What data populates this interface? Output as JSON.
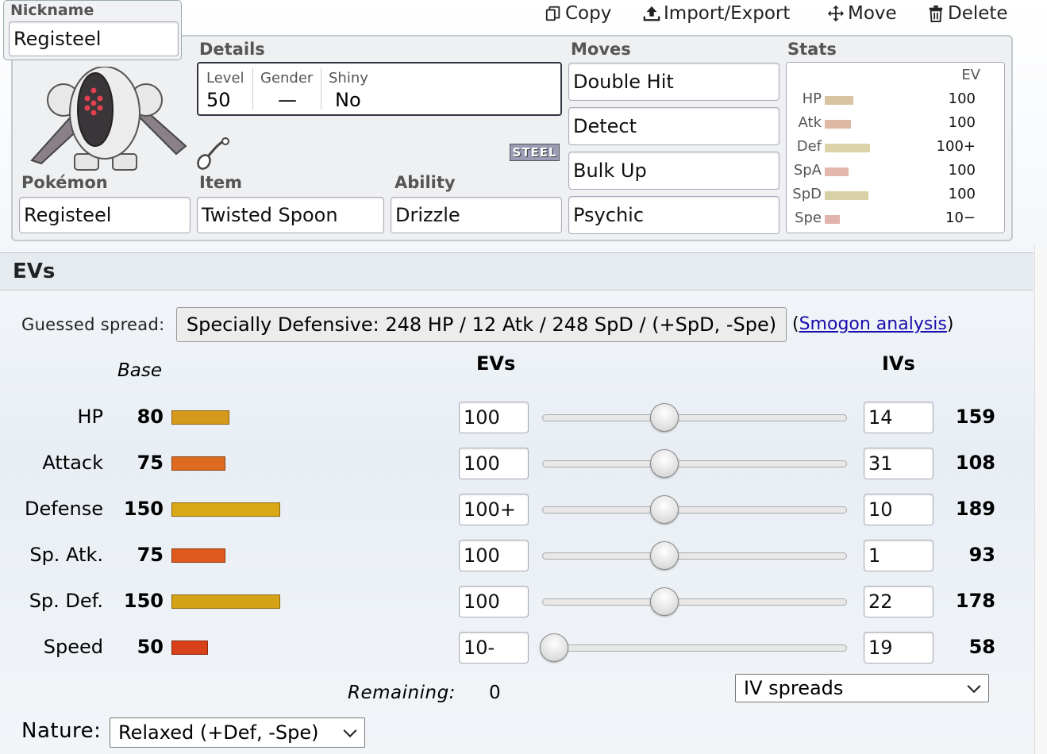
{
  "toolbar": {
    "copy": "Copy",
    "import_export": "Import/Export",
    "move": "Move",
    "delete": "Delete"
  },
  "nickname": {
    "label": "Nickname",
    "value": "Registeel"
  },
  "details": {
    "title": "Details",
    "level_label": "Level",
    "level": "50",
    "gender_label": "Gender",
    "gender": "—",
    "shiny_label": "Shiny",
    "shiny": "No",
    "type_badge": "STEEL"
  },
  "pokemon": {
    "label": "Pokémon",
    "value": "Registeel"
  },
  "item": {
    "label": "Item",
    "value": "Twisted Spoon",
    "icon": "spoon-icon"
  },
  "ability": {
    "label": "Ability",
    "value": "Drizzle"
  },
  "moves": {
    "title": "Moves",
    "list": [
      "Double Hit",
      "Detect",
      "Bulk Up",
      "Psychic"
    ]
  },
  "stats_summary": {
    "title": "Stats",
    "ev_header": "EV",
    "rows": [
      {
        "name": "HP",
        "ev": "100",
        "fill": 0.63
      },
      {
        "name": "Atk",
        "ev": "100",
        "fill": 0.58
      },
      {
        "name": "Def",
        "ev": "100+",
        "fill": 1.0
      },
      {
        "name": "SpA",
        "ev": "100",
        "fill": 0.52
      },
      {
        "name": "SpD",
        "ev": "100",
        "fill": 0.96
      },
      {
        "name": "Spe",
        "ev": "10−",
        "fill": 0.33
      }
    ]
  },
  "evs": {
    "section_title": "EVs",
    "guessed_label": "Guessed spread:",
    "guessed_value": "Specially Defensive: 248 HP / 12 Atk / 248 SpD / (+SpD, -Spe)",
    "paren_open": "(",
    "smogon_link": "Smogon analysis",
    "paren_close": ")",
    "base_header": "Base",
    "evs_header": "EVs",
    "ivs_header": "IVs",
    "rows": [
      {
        "name": "HP",
        "base": "80",
        "ev": "100",
        "slider": 0.4,
        "iv": "14",
        "total": "159",
        "color": "#d59a1c"
      },
      {
        "name": "Attack",
        "base": "75",
        "ev": "100",
        "slider": 0.4,
        "iv": "31",
        "total": "108",
        "color": "#dd6a1f"
      },
      {
        "name": "Defense",
        "base": "150",
        "ev": "100+",
        "slider": 0.4,
        "iv": "10",
        "total": "189",
        "color": "#d8a816"
      },
      {
        "name": "Sp. Atk.",
        "base": "75",
        "ev": "100",
        "slider": 0.4,
        "iv": "1",
        "total": "93",
        "color": "#dd5a1c"
      },
      {
        "name": "Sp. Def.",
        "base": "150",
        "ev": "100",
        "slider": 0.4,
        "iv": "22",
        "total": "178",
        "color": "#d5a318"
      },
      {
        "name": "Speed",
        "base": "50",
        "ev": "10-",
        "slider": 0.04,
        "iv": "19",
        "total": "58",
        "color": "#d8401a"
      }
    ],
    "remaining_label": "Remaining:",
    "remaining_value": "0",
    "iv_spreads": "IV spreads",
    "nature_label": "Nature:",
    "nature_value": "Relaxed (+Def, -Spe)"
  }
}
